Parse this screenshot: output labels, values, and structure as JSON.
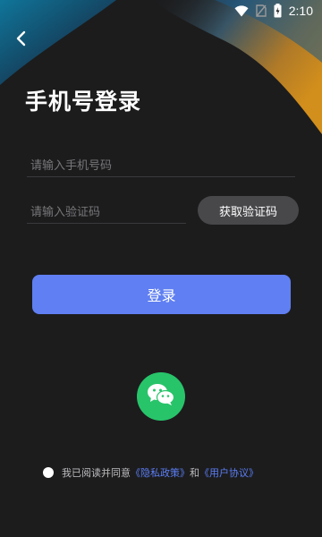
{
  "status_bar": {
    "time": "2:10",
    "icons": [
      "wifi-icon",
      "no-sim-icon",
      "battery-icon"
    ]
  },
  "header": {
    "back_icon": "chevron-left-icon"
  },
  "page": {
    "title": "手机号登录"
  },
  "form": {
    "phone_placeholder": "请输入手机号码",
    "phone_value": "",
    "code_placeholder": "请输入验证码",
    "code_value": "",
    "get_code_label": "获取验证码",
    "login_label": "登录"
  },
  "social": {
    "wechat_icon": "wechat-icon",
    "wechat_color": "#28c46a"
  },
  "agreement": {
    "prefix": "我已阅读并同意",
    "privacy_link": "《隐私政策》",
    "conjunction": "和",
    "terms_link": "《用户协议》"
  },
  "colors": {
    "background": "#1c1c1d",
    "accent": "#5f7ff2",
    "link": "#5b7ef5",
    "button_gray": "#48484b"
  }
}
